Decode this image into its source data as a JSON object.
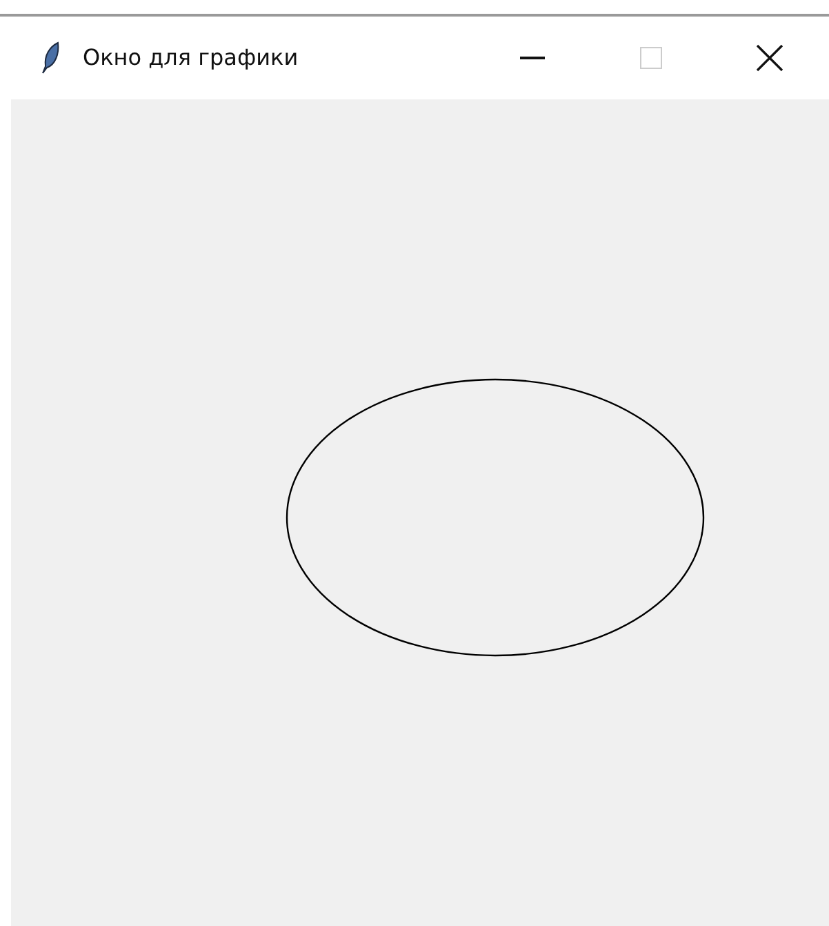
{
  "window": {
    "title": "Окно для графики",
    "maximize_disabled": true
  }
}
